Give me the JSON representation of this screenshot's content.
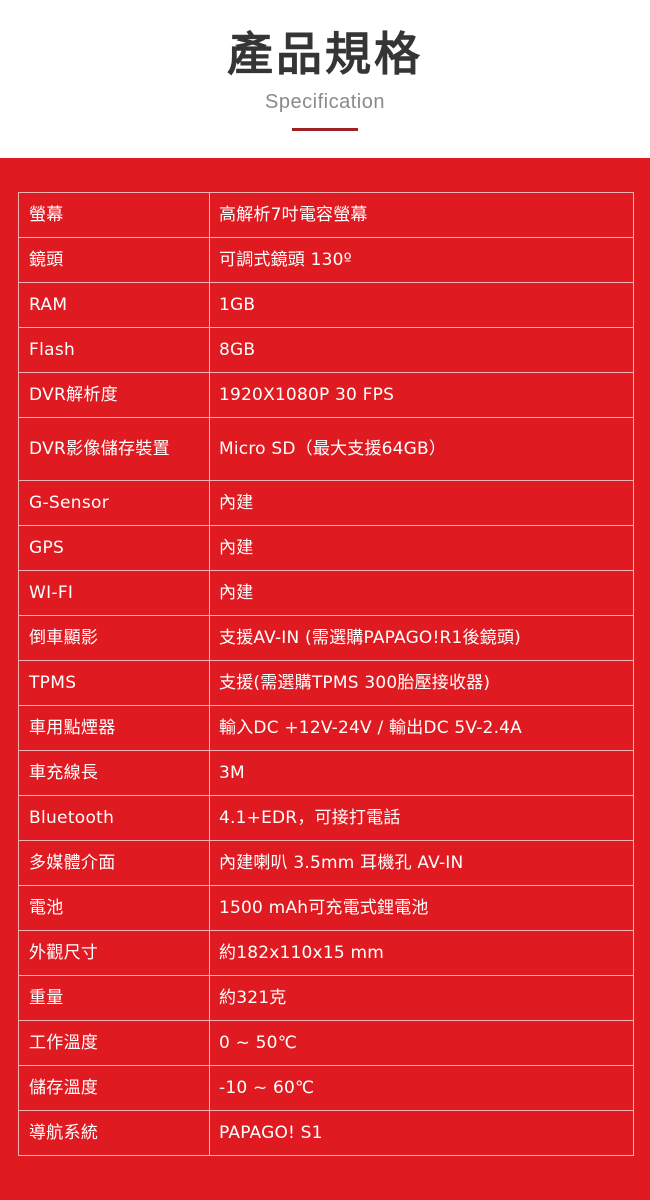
{
  "header": {
    "title": "產品規格",
    "subtitle": "Specification",
    "divider_color": "#9c2224"
  },
  "theme": {
    "band_red": "#e01a21",
    "border_pink": "#f3b3b5",
    "text_white": "#ffffff",
    "title_gray": "#353535",
    "subtitle_gray": "#8a8a8a"
  },
  "spec_table": {
    "rows": [
      {
        "label": "螢幕",
        "value": "高解析7吋電容螢幕",
        "tall": false
      },
      {
        "label": "鏡頭",
        "value": "可調式鏡頭 130º",
        "tall": false
      },
      {
        "label": "RAM",
        "value": "1GB",
        "tall": false
      },
      {
        "label": "Flash",
        "value": "8GB",
        "tall": false
      },
      {
        "label": "DVR解析度",
        "value": "1920X1080P 30 FPS",
        "tall": false
      },
      {
        "label": "DVR影像儲存裝置",
        "value": "Micro SD（最大支援64GB）",
        "tall": true
      },
      {
        "label": "G-Sensor",
        "value": "內建",
        "tall": false
      },
      {
        "label": "GPS",
        "value": "內建",
        "tall": false
      },
      {
        "label": "WI-FI",
        "value": "內建",
        "tall": false
      },
      {
        "label": "倒車顯影",
        "value": "支援AV-IN (需選購PAPAGO!R1後鏡頭)",
        "tall": false
      },
      {
        "label": "TPMS",
        "value": "支援(需選購TPMS 300胎壓接收器)",
        "tall": false
      },
      {
        "label": "車用點煙器",
        "value": "輸入DC +12V-24V / 輸出DC 5V-2.4A",
        "tall": false
      },
      {
        "label": "車充線長",
        "value": "3M",
        "tall": false
      },
      {
        "label": "Bluetooth",
        "value": "4.1+EDR，可接打電話",
        "tall": false
      },
      {
        "label": "多媒體介面",
        "value": "內建喇叭 3.5mm 耳機孔 AV-IN",
        "tall": false
      },
      {
        "label": "電池",
        "value": "1500 mAh可充電式鋰電池",
        "tall": false
      },
      {
        "label": "外觀尺寸",
        "value": "約182x110x15 mm",
        "tall": false
      },
      {
        "label": "重量",
        "value": "約321克",
        "tall": false
      },
      {
        "label": "工作溫度",
        "value": "0 ~ 50℃",
        "tall": false
      },
      {
        "label": "儲存溫度",
        "value": "-10 ~ 60℃",
        "tall": false
      },
      {
        "label": "導航系統",
        "value": "PAPAGO! S1",
        "tall": false
      }
    ]
  }
}
